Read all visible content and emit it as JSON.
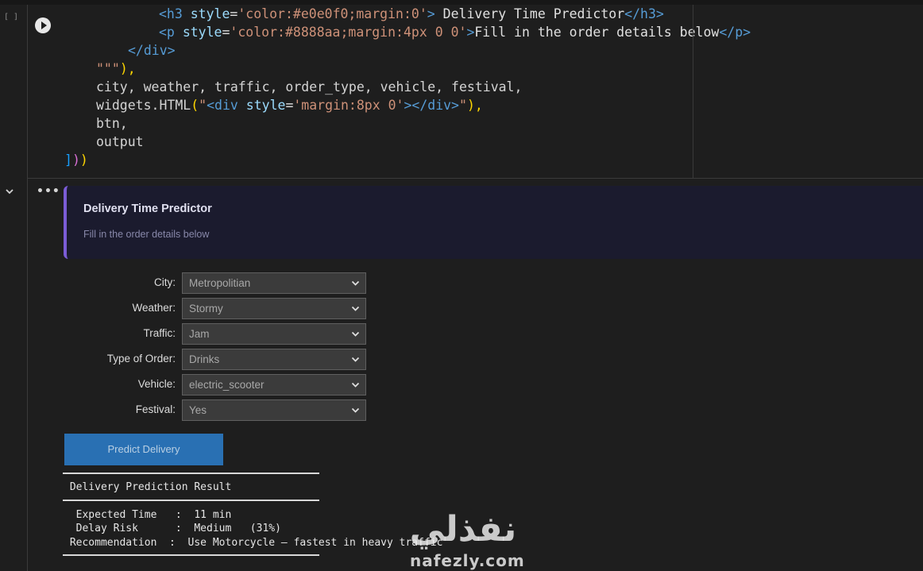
{
  "code_cell": {
    "exec_count": "[ ]",
    "lines": [
      {
        "p1": "<h3 ",
        "p2": "style",
        "p3": "=",
        "p4": "'color:#e0e0f0;margin:0'",
        "p5": ">",
        "p6": " Delivery Time Predictor",
        "p7": "</h3>"
      },
      {
        "p1": "<p ",
        "p2": "style",
        "p3": "=",
        "p4": "'color:#8888aa;margin:4px 0 0'",
        "p5": ">",
        "p6": "Fill in the order details below",
        "p7": "</p>"
      },
      {
        "p1": "</div>"
      },
      {
        "p1": "\"\"\"",
        "p2": "),"
      },
      {
        "p1": "city, weather, traffic, order_type, vehicle, festival,"
      },
      {
        "p1": "widgets.HTML",
        "p2": "(",
        "p3": "\"",
        "p4": "<div ",
        "p5": "style",
        "p6": "=",
        "p7": "'margin:8px 0'",
        "p8": "></div>",
        "p9": "\"",
        "p10": "),"
      },
      {
        "p1": "btn,"
      },
      {
        "p1": "output"
      },
      {
        "p1": "]",
        "p2": ")",
        "p3": ")"
      }
    ]
  },
  "banner": {
    "title": "Delivery Time Predictor",
    "subtitle": "Fill in the order details below"
  },
  "form": {
    "fields": [
      {
        "label": "City:",
        "value": "Metropolitian"
      },
      {
        "label": "Weather:",
        "value": "Stormy"
      },
      {
        "label": "Traffic:",
        "value": "Jam"
      },
      {
        "label": "Type of Order:",
        "value": "Drinks"
      },
      {
        "label": "Vehicle:",
        "value": "electric_scooter"
      },
      {
        "label": "Festival:",
        "value": "Yes"
      }
    ],
    "button_label": "Predict Delivery"
  },
  "result": {
    "header": " Delivery Prediction Result",
    "line1": "  Expected Time   :  11 min",
    "line2": "  Delay Risk      :  Medium   (31%)",
    "line3": " Recommendation  :  Use Motorcycle — fastest in heavy traffic"
  },
  "watermark": {
    "arabic": "نفذلي",
    "latin": "nafezly.com"
  },
  "colors": {
    "accent": "#7b5cd6",
    "button": "#2970b3",
    "banner_bg": "#1b1b2e"
  }
}
